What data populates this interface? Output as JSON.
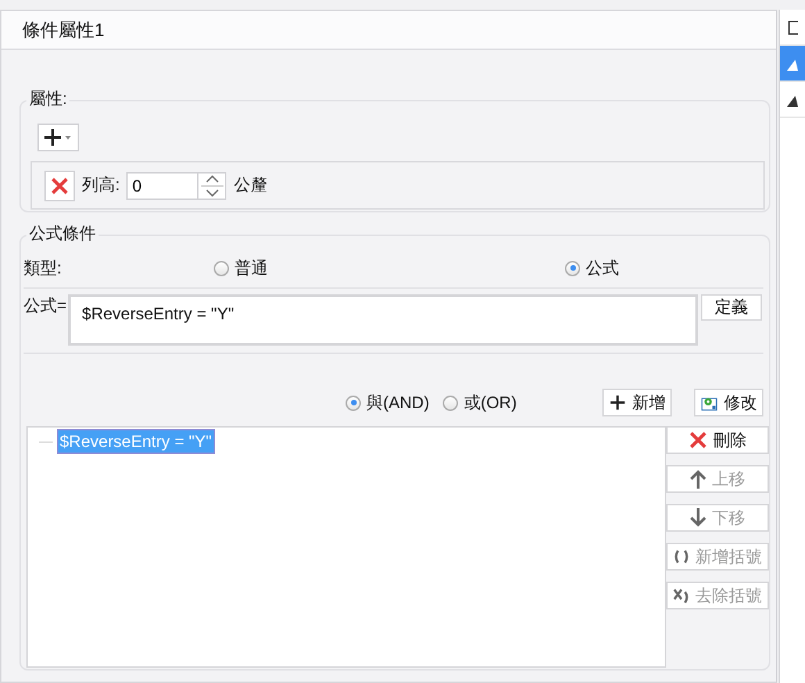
{
  "window": {
    "title": "條件屬性1"
  },
  "attributes": {
    "legend": "屬性:",
    "row": {
      "label": "列高:",
      "value": "0",
      "unit": "公釐"
    }
  },
  "formula_condition": {
    "legend": "公式條件",
    "type_label": "類型:",
    "type_options": [
      {
        "label": "普通",
        "selected": false
      },
      {
        "label": "公式",
        "selected": true
      }
    ],
    "formula_label": "公式=",
    "formula_value": "$ReverseEntry = \"Y\"",
    "define_button": "定義",
    "logic_options": [
      {
        "label": "與(AND)",
        "selected": true
      },
      {
        "label": "或(OR)",
        "selected": false
      }
    ],
    "add_button": "新增",
    "modify_button": "修改",
    "conditions": [
      {
        "text": "$ReverseEntry = \"Y\"",
        "selected": true
      }
    ],
    "side_buttons": [
      {
        "kind": "delete",
        "label": "刪除",
        "disabled": false
      },
      {
        "kind": "up",
        "label": "上移",
        "disabled": true
      },
      {
        "kind": "down",
        "label": "下移",
        "disabled": true
      },
      {
        "kind": "add-bracket",
        "label": "新增括號",
        "disabled": true
      },
      {
        "kind": "remove-bracket",
        "label": "去除括號",
        "disabled": true
      }
    ]
  },
  "side_panel": {
    "tabs": [
      {
        "kind": "square",
        "selected": false
      },
      {
        "kind": "triangle",
        "selected": true
      },
      {
        "kind": "triangle",
        "selected": false
      }
    ]
  }
}
